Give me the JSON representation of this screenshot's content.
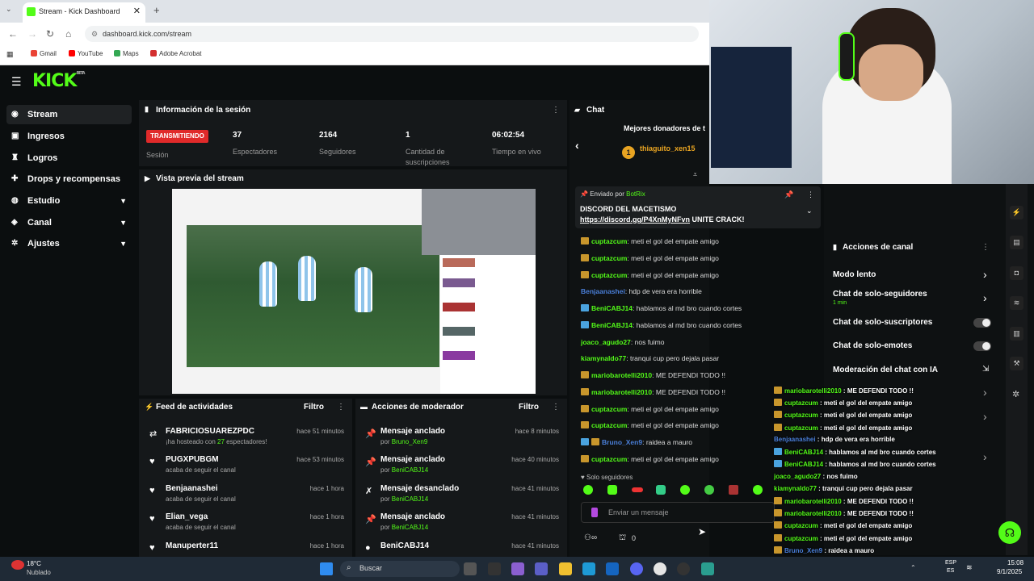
{
  "browser": {
    "tab_title": "Stream - Kick Dashboard",
    "url": "dashboard.kick.com/stream",
    "bookmarks": [
      "Gmail",
      "YouTube",
      "Maps",
      "Adobe Acrobat"
    ]
  },
  "app": {
    "logo": "KICK",
    "logo_tag": "BETA"
  },
  "sidebar": {
    "items": [
      {
        "label": "Stream",
        "icon": "stream-icon",
        "active": true
      },
      {
        "label": "Ingresos",
        "icon": "wallet-icon"
      },
      {
        "label": "Logros",
        "icon": "trophy-icon"
      },
      {
        "label": "Drops y recompensas",
        "icon": "gift-icon"
      },
      {
        "label": "Estudio",
        "icon": "studio-icon",
        "expandable": true
      },
      {
        "label": "Canal",
        "icon": "channel-icon",
        "expandable": true
      },
      {
        "label": "Ajustes",
        "icon": "gear-icon",
        "expandable": true
      }
    ]
  },
  "session": {
    "title": "Información de la sesión",
    "live_badge": "TRANSMITIENDO",
    "session_label": "Sesión",
    "stats": [
      {
        "value": "37",
        "label": "Espectadores"
      },
      {
        "value": "2164",
        "label": "Seguidores"
      },
      {
        "value": "1",
        "label": "Cantidad de suscripciones"
      },
      {
        "value": "06:02:54",
        "label": "Tiempo en vivo"
      }
    ]
  },
  "preview": {
    "title": "Vista previa del stream"
  },
  "feed": {
    "title": "Feed de actividades",
    "filter": "Filtro",
    "items": [
      {
        "name": "FABRICIOSUAREZPDC",
        "sub_pre": "¡ha hosteado con ",
        "sub_num": "27",
        "sub_post": " espectadores!",
        "time": "hace 51 minutos",
        "icon": "host-icon"
      },
      {
        "name": "PUGXPUBGM",
        "sub": "acaba de seguir el canal",
        "time": "hace 53 minutos",
        "icon": "heart-icon"
      },
      {
        "name": "Benjaanashei",
        "sub": "acaba de seguir el canal",
        "time": "hace 1 hora",
        "icon": "heart-icon"
      },
      {
        "name": "Elian_vega",
        "sub": "acaba de seguir el canal",
        "time": "hace 1 hora",
        "icon": "heart-icon"
      },
      {
        "name": "Manuperter11",
        "sub": "",
        "time": "hace 1 hora",
        "icon": "heart-icon"
      }
    ]
  },
  "modactions": {
    "title": "Acciones de moderador",
    "filter": "Filtro",
    "items": [
      {
        "action": "Mensaje anclado",
        "by": "por ",
        "user": "Bruno_Xen9",
        "time": "hace 8 minutos"
      },
      {
        "action": "Mensaje anclado",
        "by": "por ",
        "user": "BeniCABJ14",
        "time": "hace 40 minutos"
      },
      {
        "action": "Mensaje desanclado",
        "by": "por ",
        "user": "BeniCABJ14",
        "time": "hace 41 minutos"
      },
      {
        "action": "Mensaje anclado",
        "by": "por ",
        "user": "BeniCABJ14",
        "time": "hace 41 minutos"
      },
      {
        "action": "BeniCABJ14",
        "by": "",
        "user": "",
        "time": "hace 41 minutos"
      }
    ]
  },
  "chat": {
    "title": "Chat",
    "top_donors": "Mejores donadores de t",
    "donor": {
      "rank": "1",
      "name": "thiaguito_xen15"
    },
    "pinned": {
      "sent_by": "Enviado por",
      "bot": "BotRix",
      "line1": "DISCORD DEL MACETISMO",
      "link": "https://discord.gg/P4XnMyNFvn",
      "line2": " UNITE CRACK!"
    },
    "messages": [
      {
        "user": "cuptazcum",
        "text": "meti el gol del empate amigo",
        "color": "#53fc18",
        "badge": "gold"
      },
      {
        "user": "cuptazcum",
        "text": "meti el gol del empate amigo",
        "color": "#53fc18",
        "badge": "gold"
      },
      {
        "user": "cuptazcum",
        "text": "meti el gol del empate amigo",
        "color": "#53fc18",
        "badge": "gold"
      },
      {
        "user": "Benjaanashei",
        "text": "hdp de vera era horrible",
        "color": "#4a7fd9",
        "badge": ""
      },
      {
        "user": "BeniCABJ14",
        "text": "hablamos al md bro cuando cortes",
        "color": "#53fc18",
        "badge": "blue"
      },
      {
        "user": "BeniCABJ14",
        "text": "hablamos al md bro cuando cortes",
        "color": "#53fc18",
        "badge": "blue"
      },
      {
        "user": "joaco_agudo27",
        "text": "nos fuimo",
        "color": "#53fc18",
        "badge": ""
      },
      {
        "user": "kiamynaldo77",
        "text": "tranqui cup pero dejala pasar",
        "color": "#53fc18",
        "badge": ""
      },
      {
        "user": "mariobarotelli2010",
        "text": "ME DEFENDI TODO !!",
        "color": "#53fc18",
        "badge": "gold"
      },
      {
        "user": "mariobarotelli2010",
        "text": "ME DEFENDI TODO !!",
        "color": "#53fc18",
        "badge": "gold"
      },
      {
        "user": "cuptazcum",
        "text": "meti el gol del empate amigo",
        "color": "#53fc18",
        "badge": "gold"
      },
      {
        "user": "cuptazcum",
        "text": "meti el gol del empate amigo",
        "color": "#53fc18",
        "badge": "gold"
      },
      {
        "user": "Bruno_Xen9",
        "text": "raidea a mauro",
        "color": "#4a7fd9",
        "badge": "blue"
      },
      {
        "user": "cuptazcum",
        "text": "meti el gol del empate amigo",
        "color": "#53fc18",
        "badge": "gold"
      }
    ],
    "followers_only": "Solo seguidores",
    "input_placeholder": "Enviar un mensaje",
    "counter": "0"
  },
  "channel_actions": {
    "title": "Acciones de canal",
    "items": [
      {
        "label": "Modo lento",
        "sub": "",
        "control": "chevron"
      },
      {
        "label": "Chat de solo-seguidores",
        "sub": "1 min",
        "control": "chevron"
      },
      {
        "label": "Chat de solo-suscriptores",
        "sub": "",
        "control": "toggle"
      },
      {
        "label": "Chat de solo-emotes",
        "sub": "",
        "control": "toggle"
      },
      {
        "label": "Moderación del chat con IA",
        "sub": "",
        "control": "external"
      }
    ]
  },
  "overlay_chat": [
    {
      "user": "mariobarotelli2010",
      "text": "ME DEFENDI TODO !!"
    },
    {
      "user": "cuptazcum",
      "text": "meti el gol del empate amigo"
    },
    {
      "user": "cuptazcum",
      "text": "meti el gol del empate amigo"
    },
    {
      "user": "cuptazcum",
      "text": "meti el gol del empate amigo"
    },
    {
      "user": "Benjaanashei",
      "text": "hdp de vera era horrible"
    },
    {
      "user": "BeniCABJ14",
      "text": "hablamos al md bro cuando cortes"
    },
    {
      "user": "BeniCABJ14",
      "text": "hablamos al md bro cuando cortes"
    },
    {
      "user": "joaco_agudo27",
      "text": "nos fuimo"
    },
    {
      "user": "kiamynaldo77",
      "text": "tranqui cup pero dejala pasar"
    },
    {
      "user": "mariobarotelli2010",
      "text": "ME DEFENDI TODO !!"
    },
    {
      "user": "mariobarotelli2010",
      "text": "ME DEFENDI TODO !!"
    },
    {
      "user": "cuptazcum",
      "text": "meti el gol del empate amigo"
    },
    {
      "user": "cuptazcum",
      "text": "meti el gol del empate amigo"
    },
    {
      "user": "Bruno_Xen9",
      "text": "raidea a mauro"
    }
  ],
  "taskbar": {
    "weather_temp": "18°C",
    "weather_desc": "Nublado",
    "search": "Buscar",
    "lang": "ESP",
    "lang2": "ES",
    "time": "15:08",
    "date": "9/1/2025"
  }
}
